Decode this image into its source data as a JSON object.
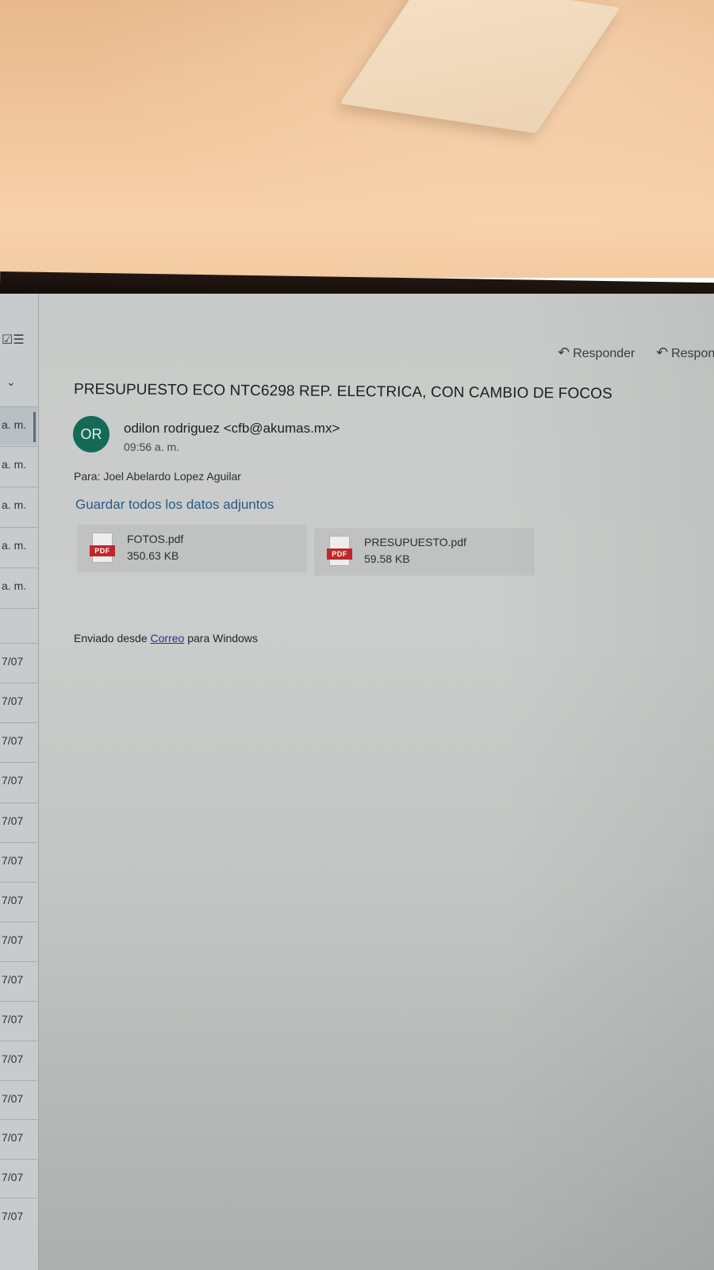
{
  "toolbar": {
    "reply_label": "Responder",
    "reply_all_label": "Respon"
  },
  "message_list": {
    "times": [
      "a. m.",
      "a. m.",
      "a. m.",
      "a. m.",
      "a. m."
    ],
    "dates": [
      "7/07",
      "7/07",
      "7/07",
      "7/07",
      "7/07",
      "7/07",
      "7/07",
      "7/07",
      "7/07",
      "7/07",
      "7/07",
      "7/07",
      "7/07",
      "7/07",
      "7/07"
    ]
  },
  "email": {
    "subject": "PRESUPUESTO ECO NTC6298 REP. ELECTRICA, CON CAMBIO DE FOCOS",
    "avatar_initials": "OR",
    "sender": "odilon rodriguez <cfb@akumas.mx>",
    "time": "09:56 a. m.",
    "to_label": "Para:",
    "to_name": "Joel Abelardo Lopez Aguilar",
    "save_all_label": "Guardar todos los datos adjuntos",
    "attachments": [
      {
        "name": "FOTOS.pdf",
        "size": "350.63 KB",
        "type": "PDF"
      },
      {
        "name": "PRESUPUESTO.pdf",
        "size": "59.58 KB",
        "type": "PDF"
      }
    ],
    "signature": {
      "prefix": "Enviado desde",
      "link": "Correo",
      "suffix": "para Windows"
    }
  },
  "colors": {
    "avatar_bg": "#156a57",
    "link": "#2a5a86",
    "pdf_red": "#c0272d"
  }
}
